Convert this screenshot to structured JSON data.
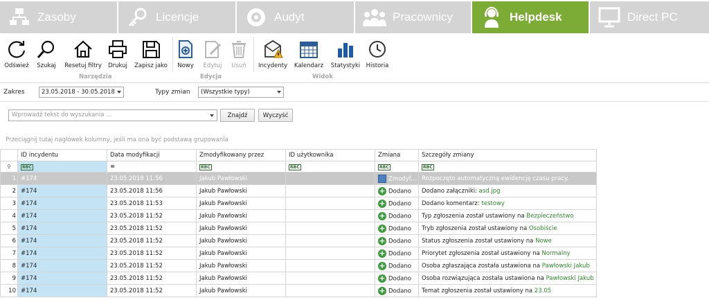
{
  "tabs": [
    {
      "label": "Zasoby",
      "icon": "network-icon"
    },
    {
      "label": "Licencje",
      "icon": "key-icon"
    },
    {
      "label": "Audyt",
      "icon": "disc-icon"
    },
    {
      "label": "Pracownicy",
      "icon": "people-icon"
    },
    {
      "label": "Helpdesk",
      "icon": "headset-icon",
      "active": true
    },
    {
      "label": "Direct PC",
      "icon": "monitor-icon"
    }
  ],
  "ribbon": {
    "buttons": [
      {
        "label": "Odśwież",
        "icon": "refresh-icon"
      },
      {
        "label": "Szukaj",
        "icon": "search-icon"
      },
      {
        "label": "Resetuj filtry",
        "icon": "home-icon"
      },
      {
        "label": "Drukuj",
        "icon": "printer-icon"
      },
      {
        "label": "Zapisz jako",
        "icon": "floppy-icon"
      },
      {
        "label": "Nowy",
        "icon": "new-document-icon"
      },
      {
        "label": "Edytuj",
        "icon": "edit-icon",
        "disabled": true
      },
      {
        "label": "Usuń",
        "icon": "trash-icon",
        "disabled": true
      },
      {
        "label": "Incydenty",
        "icon": "warning-icon"
      },
      {
        "label": "Kalendarz",
        "icon": "calendar-icon"
      },
      {
        "label": "Statystyki",
        "icon": "bar-chart-icon"
      },
      {
        "label": "Historia",
        "icon": "clock-icon"
      }
    ],
    "groups": [
      "Narzędzia",
      "Edycja",
      "Widok"
    ]
  },
  "filter": {
    "range_label": "Zakres",
    "range_value": "23.05.2018 - 30.05.2018",
    "types_label": "Typy zmian",
    "types_value": "(Wszystkie typy)"
  },
  "search": {
    "placeholder": "Wprowadź tekst do wyszukania ...",
    "find_label": "Znajdź",
    "clear_label": "Wyczyść"
  },
  "group_hint": "Przeciągnij tutaj nagłówek kolumny, jeśli ma ona być podstawą grupowania",
  "grid": {
    "columns": [
      "ID incydentu",
      "Data modyfikacji",
      "Zmodyfikowany przez",
      "ID użytkownika",
      "Zmiana",
      "Szczegóły zmiany"
    ],
    "filter_row": {
      "text_filter": "RBC",
      "equals": "="
    },
    "rows": [
      {
        "n": "1",
        "id": "#174",
        "date": "23.05.2018 11:56",
        "by": "Jakub Pawłowski",
        "uid": "",
        "change": "Zmodyf...",
        "kind": "mod",
        "detail": "Rozpoczęto automatyczną ewidencję czasu pracy.",
        "value": ""
      },
      {
        "n": "2",
        "id": "#174",
        "date": "23.05.2018 11:56",
        "by": "Jakub Pawłowski",
        "uid": "",
        "change": "Dodano",
        "kind": "add",
        "detail": "Dodano załączniki:",
        "value": "asd.jpg"
      },
      {
        "n": "3",
        "id": "#174",
        "date": "23.05.2018 11:53",
        "by": "Jakub Pawłowski",
        "uid": "",
        "change": "Dodano",
        "kind": "add",
        "detail": "Dodano komentarz:",
        "value": "testowy"
      },
      {
        "n": "4",
        "id": "#174",
        "date": "23.05.2018 11:52",
        "by": "Jakub Pawłowski",
        "uid": "",
        "change": "Dodano",
        "kind": "add",
        "detail": "Typ zgłoszenia został ustawiony na",
        "value": "Bezpieczeństwo"
      },
      {
        "n": "5",
        "id": "#174",
        "date": "23.05.2018 11:52",
        "by": "Jakub Pawłowski",
        "uid": "",
        "change": "Dodano",
        "kind": "add",
        "detail": "Tryb zgłoszenia został ustawiony na",
        "value": "Osobiście"
      },
      {
        "n": "6",
        "id": "#174",
        "date": "23.05.2018 11:52",
        "by": "Jakub Pawłowski",
        "uid": "",
        "change": "Dodano",
        "kind": "add",
        "detail": "Status zgłoszenia został ustawiony na",
        "value": "Nowe"
      },
      {
        "n": "7",
        "id": "#174",
        "date": "23.05.2018 11:52",
        "by": "Jakub Pawłowski",
        "uid": "",
        "change": "Dodano",
        "kind": "add",
        "detail": "Priorytet zgłoszenia został ustawiony na",
        "value": "Normalny"
      },
      {
        "n": "8",
        "id": "#174",
        "date": "23.05.2018 11:52",
        "by": "Jakub Pawłowski",
        "uid": "",
        "change": "Dodano",
        "kind": "add",
        "detail": "Osoba zgłaszająca została ustawiona na",
        "value": "Pawłowski Jakub"
      },
      {
        "n": "9",
        "id": "#174",
        "date": "23.05.2018 11:52",
        "by": "Jakub Pawłowski",
        "uid": "",
        "change": "Dodano",
        "kind": "add",
        "detail": "Osoba rozwiązująca została ustawiona na",
        "value": "Pawłowski Jakub"
      },
      {
        "n": "10",
        "id": "#174",
        "date": "23.05.2018 11:52",
        "by": "Jakub Pawłowski",
        "uid": "",
        "change": "Dodano",
        "kind": "add",
        "detail": "Temat zgłoszenia został ustawiony na",
        "value": "23.05"
      }
    ]
  },
  "colors": {
    "active_tab": "#7cab36",
    "inactive_tab": "#d4d4d4",
    "id_cell": "#c4e3f5",
    "selected_row": "#c8c8c8",
    "value_green": "#2b8a2b"
  }
}
